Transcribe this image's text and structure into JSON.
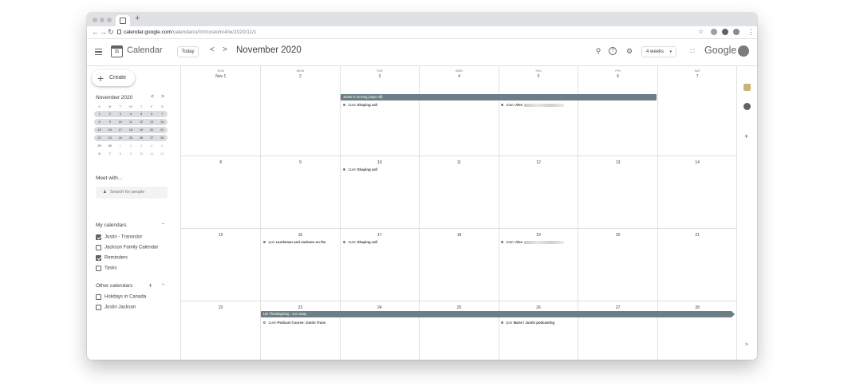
{
  "browser": {
    "new_tab": "+",
    "url_host": "calendar.google.com",
    "url_path": "/calendar/u/0/r/custom/4/w/2020/11/1"
  },
  "header": {
    "app_name": "Calendar",
    "logo_text": "31",
    "today_label": "Today",
    "prev": "<",
    "next": ">",
    "month_title": "November 2020",
    "view_label": "4 weeks",
    "brand": "Google",
    "icons": [
      "search-icon",
      "help-icon",
      "settings-icon",
      "apps-icon"
    ]
  },
  "sidebar": {
    "create_label": "Create",
    "mini_calendar": {
      "title": "November 2020",
      "prev": "<",
      "next": ">",
      "weekdays": [
        "S",
        "M",
        "T",
        "W",
        "T",
        "F",
        "S"
      ],
      "weeks": [
        [
          "1",
          "2",
          "3",
          "4",
          "5",
          "6",
          "7"
        ],
        [
          "8",
          "9",
          "10",
          "11",
          "12",
          "13",
          "14"
        ],
        [
          "15",
          "16",
          "17",
          "18",
          "19",
          "20",
          "21"
        ],
        [
          "22",
          "23",
          "24",
          "25",
          "26",
          "27",
          "28"
        ],
        [
          "29",
          "30",
          "1",
          "2",
          "3",
          "4",
          "5"
        ],
        [
          "6",
          "7",
          "8",
          "9",
          "10",
          "11",
          "12"
        ]
      ],
      "highlighted_weeks": 4
    },
    "meet_title": "Meet with...",
    "people_placeholder": "Search for people",
    "my_calendars_title": "My calendars",
    "my_calendars": [
      {
        "label": "Justin - Transistor",
        "checked": true
      },
      {
        "label": "Jackson Family Calendar",
        "checked": false
      },
      {
        "label": "Reminders",
        "checked": true
      },
      {
        "label": "Tasks",
        "checked": false
      }
    ],
    "other_calendars_title": "Other calendars",
    "other_calendars": [
      {
        "label": "Holidays in Canada",
        "checked": false
      },
      {
        "label": "Justin Jackson",
        "checked": false
      }
    ]
  },
  "grid": {
    "weekdays": [
      "SUN",
      "MON",
      "TUE",
      "WED",
      "THU",
      "FRI",
      "SAT"
    ],
    "weeks": [
      [
        "Nov 1",
        "2",
        "3",
        "4",
        "5",
        "6",
        "7"
      ],
      [
        "8",
        "9",
        "10",
        "11",
        "12",
        "13",
        "14"
      ],
      [
        "15",
        "16",
        "17",
        "18",
        "19",
        "20",
        "21"
      ],
      [
        "22",
        "23",
        "24",
        "25",
        "26",
        "27",
        "28"
      ]
    ],
    "banners": {
      "moving": "Justin is moving (days off)",
      "thanksgiving": "US Thanksgiving · Jon away"
    },
    "events": {
      "w1_tue": {
        "time": "11am",
        "title": "Shaping call"
      },
      "w1_thu": {
        "time": "10am",
        "title": "Ales"
      },
      "w2_tue": {
        "time": "11am",
        "title": "Shaping call"
      },
      "w3_mon": {
        "time": "1pm",
        "title": "Landsman and Jackson on the"
      },
      "w3_tue": {
        "time": "11am",
        "title": "Shaping call"
      },
      "w3_thu": {
        "time": "10am",
        "title": "Ales"
      },
      "w4_mon": {
        "time": "11am",
        "title": "Podcast Course: Justin Trans"
      },
      "w4_thu": {
        "time": "2pm",
        "title": "Marie / Justin podcasting"
      }
    }
  },
  "rail": {
    "plus": "+",
    "expand": ">"
  },
  "colors": {
    "event": "#6d7f86",
    "grid_line": "#e0e0e0",
    "text": "#3c4043"
  }
}
